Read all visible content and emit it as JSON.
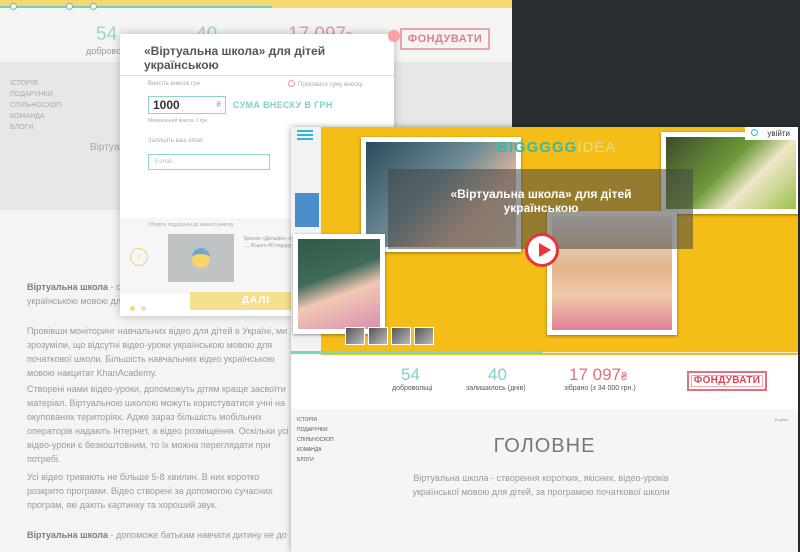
{
  "back": {
    "stats": [
      {
        "value": "54",
        "label": "добровольці"
      },
      {
        "value": "40",
        "label": ""
      },
      {
        "value": "17 097",
        "label": "",
        "currency": "₴"
      }
    ],
    "fund_label": "ФОНДУВАТИ",
    "nav": [
      "ІСТОРІЯ",
      "ПОДАРУНКИ",
      "СПІЛЬНОСХОП",
      "КОМАНДА",
      "БЛОГИ"
    ],
    "faint_title": "Віртуальна",
    "paragraphs": [
      {
        "bold": "Віртуальна школа",
        "text": " - створення коротких, якісних, відео-уроків українською мовою для дітей."
      },
      {
        "bold": "",
        "text": "Провівши моніторинг навчальних відео для дітей в Україні, ми зрозуміли, що відсутні відео-уроки українською мовою для початкової школи. Більшість навчальних відео українською мовою накцитат KhanAcademy."
      },
      {
        "bold": "",
        "text": "Створені нами відео-уроки, допоможуть дітям краще засвоїти матеріал. Віртуальною школою можуть користуватися учні на окупованих територіях. Адже зараз більшість мобільних операторів надають Інтернет, а відео розміщення. Оскільки усі відео-уроки є безкоштовним, то їх можна переглядати при потребі."
      },
      {
        "bold": "",
        "text": "Усі відео тривають не більше 5-8 хвилин. В них коротко розкрито програми. Відео створені за допомогою сучасних програм, які дають картинку та хороший звук."
      },
      {
        "bold": "Віртуальна школа",
        "text": " - допоможе батькам навчати дитину не до"
      }
    ]
  },
  "modal": {
    "title": "«Віртуальна школа» для дітей українською",
    "hint_left": "Внесіть внесок грн",
    "hint_right": "Приховати суму внеску",
    "amount": "1000",
    "currency": "₴",
    "amount_label": "СУМА ВНЕСКУ В ГРН",
    "min_hint": "Мінімальний внесок 1 грн",
    "email_label": "Залишіть ваш email",
    "email_placeholder": "E-mail",
    "gift_hint": "Оберіть подарунок до вашого внеску",
    "gift_text": "Брелок «Дельфін» палітра тонів ..., Всього 40 подарунків",
    "next_label": "ДАЛІ",
    "prev_icon": "‹"
  },
  "front": {
    "login_label": "увійти",
    "logo_main": "BIGGGGG",
    "logo_accent": "IDEA",
    "hero_title": "«Віртуальна школа» для дітей українською",
    "stats": [
      {
        "value": "54",
        "label": "добровольці"
      },
      {
        "value": "40",
        "label": "залишилось (днів)"
      },
      {
        "value": "17 097",
        "currency": "₴",
        "label": "зібрано (з 34 000 грн.)"
      }
    ],
    "fund_label": "ФОНДУВАТИ",
    "nav": [
      "ІСТОРІЯ",
      "ПОДАРУНКИ",
      "СПІЛЬНОСХОП",
      "КОМАНДА",
      "БЛОГИ"
    ],
    "lang": "English",
    "heading": "ГОЛОВНЕ",
    "subtext": "Віртуальна школа - створення коротких, якісних, відео-уроків української мовою для дітей, за програмою початкової школи"
  },
  "colors": {
    "hero": "#f5bd17",
    "accent_teal": "#7fd2c5",
    "accent_red": "#e46f7d"
  }
}
